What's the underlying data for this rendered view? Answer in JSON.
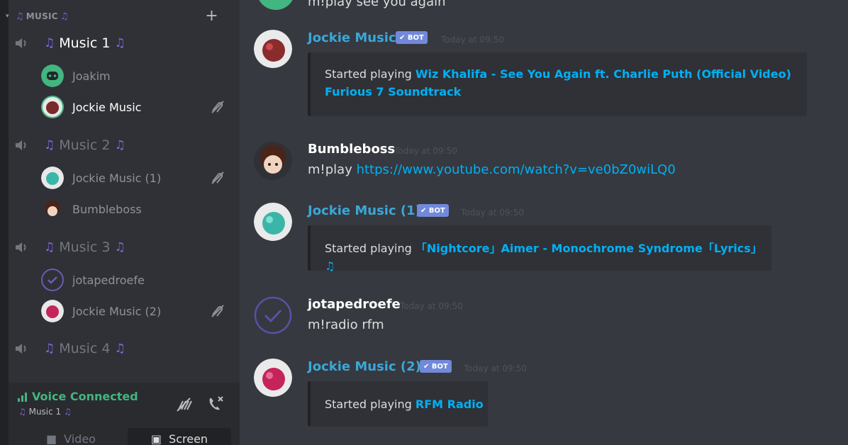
{
  "sidebar": {
    "category": {
      "label": "MUSIC"
    },
    "channels": [
      {
        "name": "Music 1",
        "users": [
          {
            "name": "Joakim"
          },
          {
            "name": "Jockie Music"
          }
        ]
      },
      {
        "name": "Music 2",
        "users": [
          {
            "name": "Jockie Music (1)"
          },
          {
            "name": "Bumbleboss"
          }
        ]
      },
      {
        "name": "Music 3",
        "users": [
          {
            "name": "jotapedroefe"
          },
          {
            "name": "Jockie Music (2)"
          }
        ]
      },
      {
        "name": "Music 4",
        "users": []
      }
    ],
    "voice": {
      "status": "Voice Connected",
      "channel": "Music 1"
    },
    "buttons": {
      "video": "Video",
      "screen": "Screen"
    }
  },
  "chat": {
    "top_partial": "m!play see you again",
    "messages": [
      {
        "author": "Jockie Music",
        "bot": "✔ BOT",
        "time": "Today at 09:50",
        "embed_prefix": "Started playing",
        "embed_link_line1": "Wiz Khalifa - See You Again ft. Charlie Puth (Official Video)",
        "embed_link_line2": "Furious 7 Soundtrack"
      },
      {
        "author": "Bumbleboss",
        "time": "Today at 09:50",
        "text_prefix": "m!play",
        "link": "https://www.youtube.com/watch?v=ve0bZ0wiLQ0"
      },
      {
        "author": "Jockie Music (1)",
        "bot": "✔ BOT",
        "time": "Today at 09:50",
        "embed_prefix": "Started playing",
        "embed_link": "「Nightcore」Aimer - Monochrome Syndrome「Lyrics」♫"
      },
      {
        "author": "jotapedroefe",
        "time": "Today at 09:50",
        "text": "m!radio rfm"
      },
      {
        "author": "Jockie Music (2)",
        "bot": "✔ BOT",
        "time": "Today at 09:50",
        "embed_prefix": "Started playing",
        "embed_link": "RFM Radio"
      }
    ]
  },
  "colors": {
    "accent": "#7289da",
    "link": "#00b0f4",
    "online": "#43b581",
    "bot_name": "#3aa7d8"
  },
  "icons": [
    "speaker-icon",
    "music-note-icon",
    "plus-icon",
    "mute-icon",
    "signal-icon",
    "disconnect-icon",
    "noise-icon",
    "video-icon",
    "screen-icon"
  ]
}
